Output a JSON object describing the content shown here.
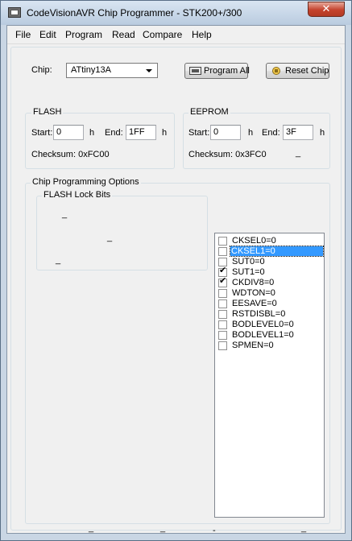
{
  "window": {
    "title": "CodeVisionAVR Chip Programmer - STK200+/300",
    "close_glyph": "✕"
  },
  "menu": [
    "File",
    "Edit",
    "Program",
    "Read",
    "Compare",
    "Help"
  ],
  "chip": {
    "label": "Chip:",
    "selected": "ATtiny13A"
  },
  "buttons": {
    "program_all": "Program All",
    "reset_chip": "Reset Chip"
  },
  "flash": {
    "title": "FLASH",
    "start_label": "Start:",
    "start_value": "0",
    "start_unit": "h",
    "end_label": "End:",
    "end_value": "1FF",
    "end_unit": "h",
    "checksum": "Checksum: 0xFC00"
  },
  "eeprom": {
    "title": "EEPROM",
    "start_label": "Start:",
    "start_value": "0",
    "start_unit": "h",
    "end_label": "End:",
    "end_value": "3F",
    "end_unit": "h",
    "checksum": "Checksum: 0x3FC0",
    "dash": "_"
  },
  "options": {
    "title": "Chip Programming Options",
    "lock_bits_title": "FLASH Lock Bits",
    "dash": "_",
    "dash_single": "-"
  },
  "fuses": [
    {
      "label": "CKSEL0=0",
      "checked": false,
      "selected": false
    },
    {
      "label": "CKSEL1=0",
      "checked": false,
      "selected": true
    },
    {
      "label": "SUT0=0",
      "checked": false,
      "selected": false
    },
    {
      "label": "SUT1=0",
      "checked": true,
      "selected": false
    },
    {
      "label": "CKDIV8=0",
      "checked": true,
      "selected": false
    },
    {
      "label": "WDTON=0",
      "checked": false,
      "selected": false
    },
    {
      "label": "EESAVE=0",
      "checked": false,
      "selected": false
    },
    {
      "label": "RSTDISBL=0",
      "checked": false,
      "selected": false
    },
    {
      "label": "BODLEVEL0=0",
      "checked": false,
      "selected": false
    },
    {
      "label": "BODLEVEL1=0",
      "checked": false,
      "selected": false
    },
    {
      "label": "SPMEN=0",
      "checked": false,
      "selected": false
    }
  ],
  "check_glyph": "✔"
}
